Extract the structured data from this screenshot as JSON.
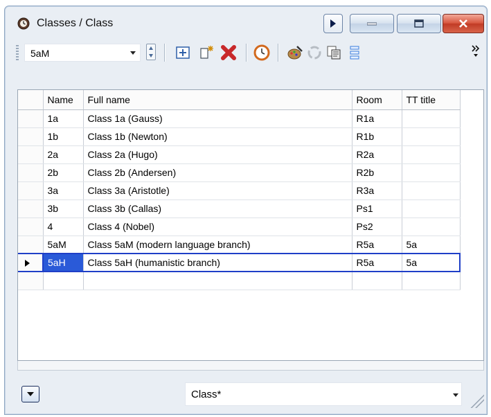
{
  "window": {
    "title": "Classes / Class",
    "icon": "clock-gear-icon"
  },
  "toolbar": {
    "class_selector_value": "5aM",
    "tools": [
      "properties-icon",
      "new-item-icon",
      "delete-icon",
      "time-off-icon",
      "edit-palette-icon",
      "refresh-icon",
      "copy-icon",
      "list-icon"
    ],
    "more_label": "»"
  },
  "grid": {
    "columns": [
      "Name",
      "Full name",
      "Room",
      "TT title"
    ],
    "rows": [
      {
        "name": "1a",
        "full": "Class 1a (Gauss)",
        "room": "R1a",
        "tt": ""
      },
      {
        "name": "1b",
        "full": "Class 1b (Newton)",
        "room": "R1b",
        "tt": ""
      },
      {
        "name": "2a",
        "full": "Class 2a (Hugo)",
        "room": "R2a",
        "tt": ""
      },
      {
        "name": "2b",
        "full": "Class 2b (Andersen)",
        "room": "R2b",
        "tt": ""
      },
      {
        "name": "3a",
        "full": "Class 3a (Aristotle)",
        "room": "R3a",
        "tt": ""
      },
      {
        "name": "3b",
        "full": "Class 3b (Callas)",
        "room": "Ps1",
        "tt": ""
      },
      {
        "name": "4",
        "full": "Class 4 (Nobel)",
        "room": "Ps2",
        "tt": ""
      },
      {
        "name": "5aM",
        "full": "Class 5aM (modern language branch)",
        "room": "R5a",
        "tt": "5a"
      },
      {
        "name": "5aH",
        "full": "Class 5aH (humanistic branch)",
        "room": "R5a",
        "tt": "5a"
      },
      {
        "name": "",
        "full": "",
        "room": "",
        "tt": ""
      }
    ],
    "current_row_index": 8
  },
  "footer": {
    "view_selector_value": "Class*"
  },
  "colors": {
    "selection": "#2a5ad8",
    "close_button": "#c13b25"
  }
}
